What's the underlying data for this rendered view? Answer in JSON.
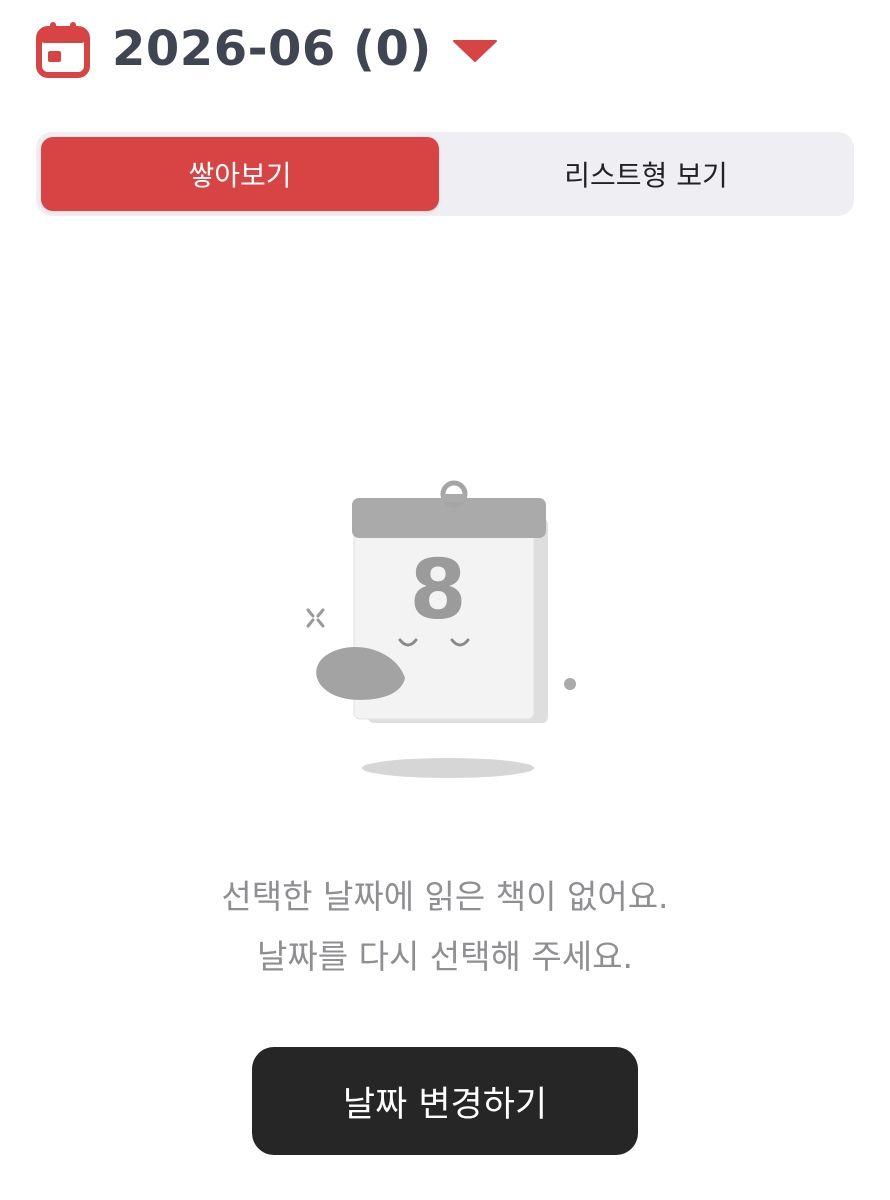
{
  "header": {
    "month_label": "2026-06 (0)",
    "calendar_icon": "calendar-icon",
    "dropdown_icon": "caret-down-icon"
  },
  "view_toggle": {
    "options": [
      {
        "label": "쌓아보기",
        "selected": true
      },
      {
        "label": "리스트형 보기",
        "selected": false
      }
    ]
  },
  "empty_state": {
    "illustration": "sleeping-calendar-illustration",
    "illustration_digit": "8",
    "line1": "선택한 날짜에 읽은 책이 없어요.",
    "line2": "날짜를 다시 선택해 주세요."
  },
  "actions": {
    "change_date_label": "날짜 변경하기"
  },
  "colors": {
    "accent": "#d84444",
    "title": "#3f4652",
    "toggle_bg": "#efeff3",
    "message": "#8e8e93",
    "button_bg": "#262626"
  }
}
